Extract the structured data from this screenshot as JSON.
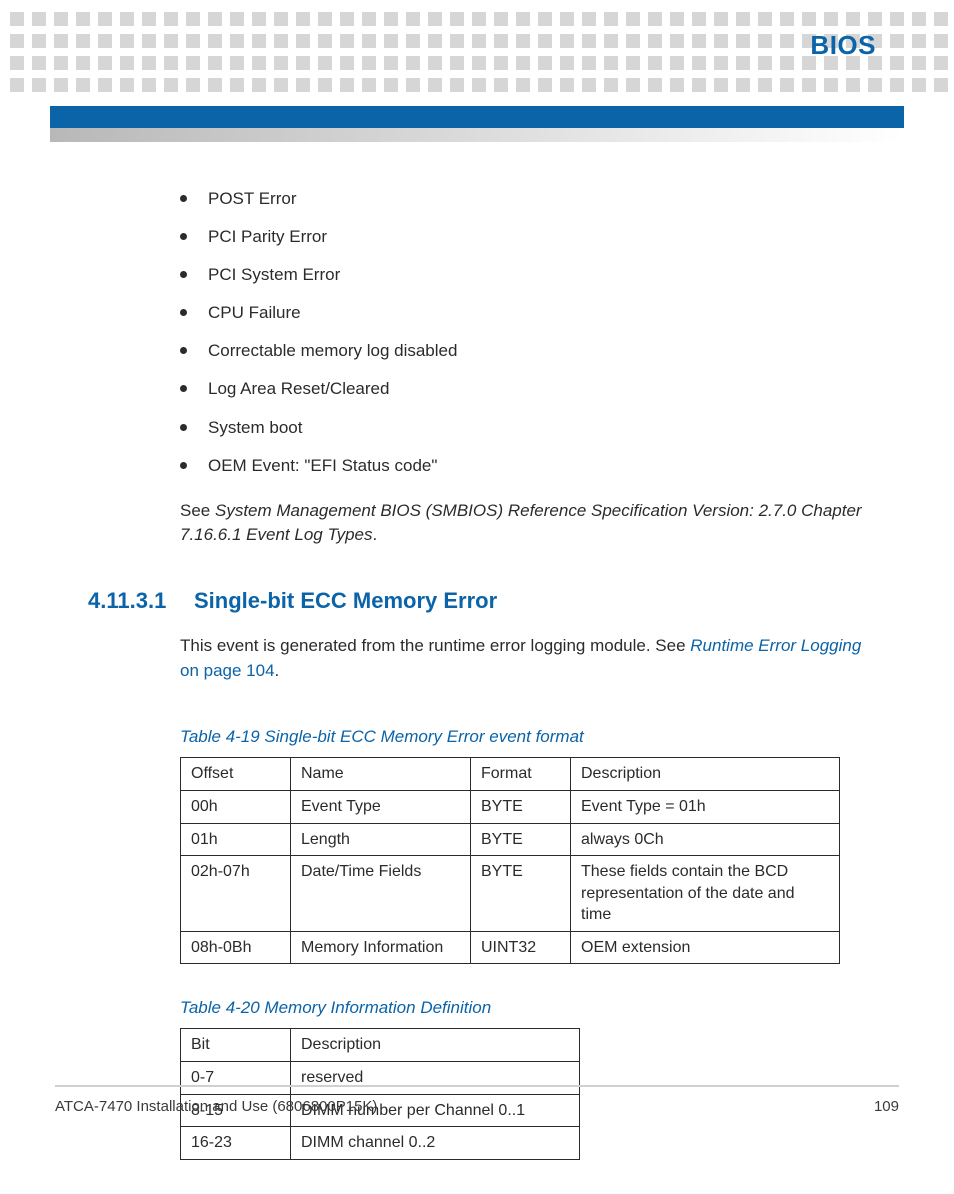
{
  "chapter": "BIOS",
  "bullets": [
    "POST Error",
    "PCI Parity Error",
    "PCI System Error",
    "CPU Failure",
    "Correctable memory log disabled",
    "Log Area Reset/Cleared",
    "System boot",
    "OEM Event: \"EFI Status code\""
  ],
  "see_prefix": "See ",
  "see_italic": "System Management BIOS (SMBIOS) Reference Specification Version: 2.7.0 Chapter 7.16.6.1 Event Log Types",
  "see_suffix": ".",
  "section": {
    "number": "4.11.3.1",
    "title": "Single-bit ECC Memory Error"
  },
  "event_para_a": "This event is generated from the runtime error logging module. See ",
  "event_link": "Runtime Error Logging",
  "event_link_trail": " on page 104",
  "event_para_b": ".",
  "table1": {
    "caption": "Table 4-19 Single-bit ECC Memory Error event format",
    "headers": [
      "Offset",
      "Name",
      "Format",
      "Description"
    ],
    "rows": [
      [
        "00h",
        "Event Type",
        "BYTE",
        "Event Type = 01h"
      ],
      [
        "01h",
        "Length",
        "BYTE",
        "always 0Ch"
      ],
      [
        "02h-07h",
        "Date/Time Fields",
        "BYTE",
        "These fields contain the BCD representation of the date and time"
      ],
      [
        "08h-0Bh",
        "Memory Information",
        "UINT32",
        "OEM extension"
      ]
    ]
  },
  "table2": {
    "caption": "Table 4-20 Memory Information Definition",
    "headers": [
      "Bit",
      "Description"
    ],
    "rows": [
      [
        "0-7",
        "reserved"
      ],
      [
        "8-15",
        "DIMM number per Channel 0..1"
      ],
      [
        "16-23",
        "DIMM channel 0..2"
      ]
    ]
  },
  "footer": {
    "doc": "ATCA-7470 Installation and Use (6806800P15K)",
    "page": "109"
  }
}
